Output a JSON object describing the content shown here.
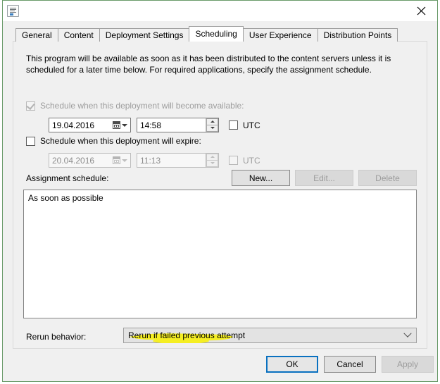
{
  "window": {
    "title": "",
    "title_redacted": true,
    "icon": "properties-document-icon",
    "close_label": "✕"
  },
  "tabs": [
    {
      "label": "General",
      "active": false
    },
    {
      "label": "Content",
      "active": false
    },
    {
      "label": "Deployment Settings",
      "active": false
    },
    {
      "label": "Scheduling",
      "active": true
    },
    {
      "label": "User Experience",
      "active": false
    },
    {
      "label": "Distribution Points",
      "active": false
    }
  ],
  "scheduling": {
    "description": "This program will be available as soon as it has been distributed to the content servers unless it is scheduled for a later time below. For required applications, specify the assignment schedule.",
    "available": {
      "checkbox_label": "Schedule when this deployment will become available:",
      "checked": true,
      "enabled": false,
      "date": "19.04.2016",
      "time": "14:58",
      "utc_label": "UTC",
      "utc_checked": false,
      "utc_enabled": true
    },
    "expire": {
      "checkbox_label": "Schedule when this deployment will expire:",
      "checked": false,
      "enabled": true,
      "date": "20.04.2016",
      "time": "11:13",
      "utc_label": "UTC",
      "utc_checked": false,
      "utc_enabled": false
    },
    "assignment": {
      "label": "Assignment schedule:",
      "buttons": {
        "new": "New...",
        "edit": "Edit...",
        "delete": "Delete"
      },
      "items": [
        "As soon as possible"
      ]
    },
    "rerun": {
      "label": "Rerun behavior:",
      "value": "Rerun if failed previous attempt",
      "highlighted": true,
      "highlight_color": "#f5ee23"
    }
  },
  "footer": {
    "ok": "OK",
    "cancel": "Cancel",
    "apply": "Apply"
  },
  "colors": {
    "window_border": "#6a9b6a",
    "dialog_bg": "#f0f0f0",
    "focus_blue": "#0a71c0",
    "highlight_yellow": "#f5ee23",
    "redaction_black": "#111111"
  }
}
